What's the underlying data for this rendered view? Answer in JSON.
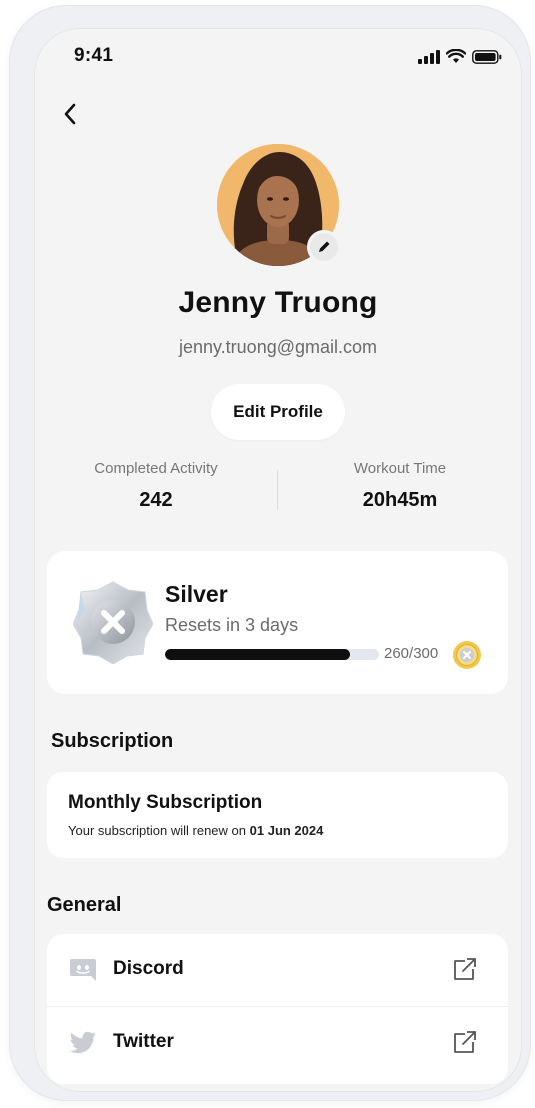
{
  "status_bar": {
    "time": "9:41"
  },
  "profile": {
    "name": "Jenny Truong",
    "email": "jenny.truong@gmail.com",
    "edit_label": "Edit Profile"
  },
  "stats": [
    {
      "label": "Completed Activity",
      "value": "242"
    },
    {
      "label": "Workout Time",
      "value": "20h45m"
    }
  ],
  "tier": {
    "name": "Silver",
    "reset_text": "Resets in 3 days",
    "progress_text": "260/300",
    "progress_current": 260,
    "progress_total": 300
  },
  "subscription": {
    "section_title": "Subscription",
    "title": "Monthly Subscription",
    "renew_prefix": "Your subscription will renew on",
    "renew_date": "01 Jun 2024"
  },
  "general": {
    "section_title": "General",
    "items": [
      {
        "label": "Discord",
        "icon": "discord-icon"
      },
      {
        "label": "Twitter",
        "icon": "twitter-icon"
      }
    ]
  },
  "colors": {
    "background": "#f4f4f4",
    "card": "#ffffff",
    "text_primary": "#111111",
    "text_secondary": "#6b6b6b",
    "progress_fill": "#0f0f0f",
    "progress_track": "#e4e7ee",
    "coin": "#f2c94c"
  }
}
